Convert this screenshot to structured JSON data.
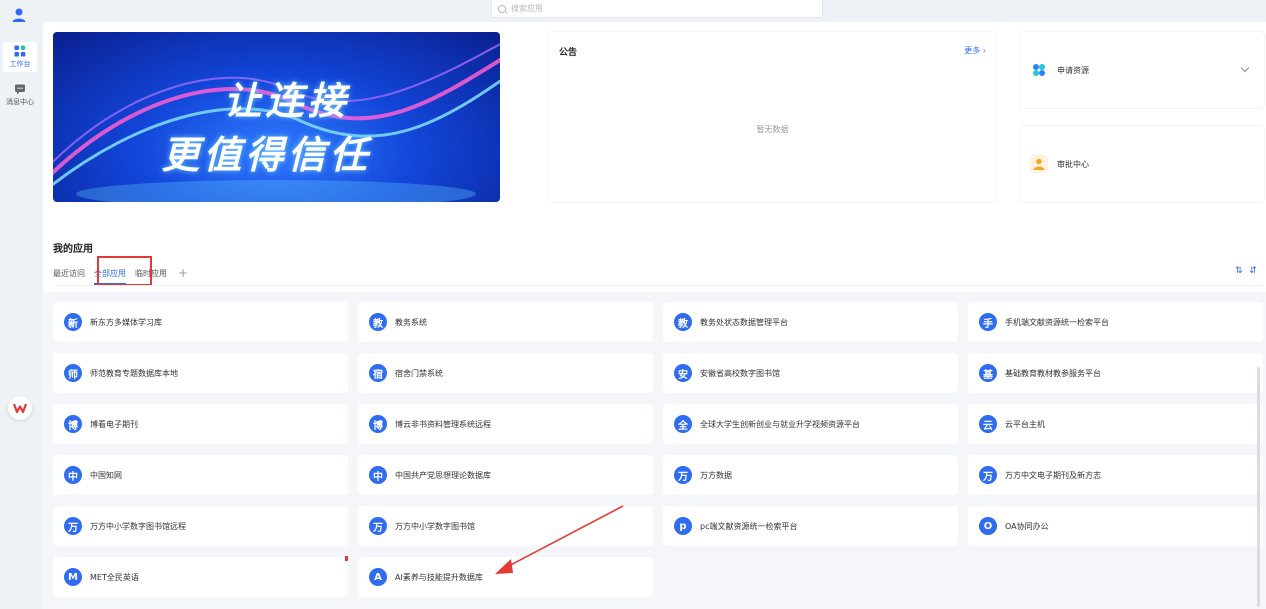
{
  "search": {
    "placeholder": "搜索应用"
  },
  "rail": {
    "items": [
      {
        "label": "工作台"
      },
      {
        "label": "消息中心"
      }
    ]
  },
  "banner": {
    "line1": "让连接",
    "line2": "更值得信任"
  },
  "notice": {
    "title": "公告",
    "more": "更多 ›",
    "empty": "暂无数据"
  },
  "side_cards": [
    {
      "label": "申请资源",
      "icon": "apps-icon",
      "color": "#2f80f5"
    },
    {
      "label": "审批中心",
      "icon": "person-icon",
      "color": "#f5a623"
    }
  ],
  "apps_section": {
    "title": "我的应用",
    "tabs": [
      "最近访问",
      "全部应用",
      "临时应用"
    ],
    "add": "+",
    "sort": "⇅ ⇵"
  },
  "apps": [
    {
      "badge": "新",
      "name": "新东方多媒体学习库"
    },
    {
      "badge": "教",
      "name": "教务系统"
    },
    {
      "badge": "教",
      "name": "教务处状态数据管理平台"
    },
    {
      "badge": "手",
      "name": "手机端文献资源统一检索平台"
    },
    {
      "badge": "师",
      "name": "师范教育专题数据库本地"
    },
    {
      "badge": "宿",
      "name": "宿舍门禁系统"
    },
    {
      "badge": "安",
      "name": "安徽省高校数字图书馆"
    },
    {
      "badge": "基",
      "name": "基础教育教材教参服务平台"
    },
    {
      "badge": "博",
      "name": "博看电子期刊"
    },
    {
      "badge": "博",
      "name": "博云非书资料管理系统远程"
    },
    {
      "badge": "全",
      "name": "全球大学生创新创业与就业升学视频资源平台"
    },
    {
      "badge": "云",
      "name": "云平台主机"
    },
    {
      "badge": "中",
      "name": "中国知网"
    },
    {
      "badge": "中",
      "name": "中国共产党思想理论数据库"
    },
    {
      "badge": "万",
      "name": "万方数据"
    },
    {
      "badge": "万",
      "name": "万方中文电子期刊及新方志"
    },
    {
      "badge": "万",
      "name": "万方中小学数字图书馆远程"
    },
    {
      "badge": "万",
      "name": "万方中小学数字图书馆"
    },
    {
      "badge": "p",
      "name": "pc端文献资源统一检索平台"
    },
    {
      "badge": "O",
      "name": "OA协同办公"
    },
    {
      "badge": "M",
      "name": "MET全民英语"
    },
    {
      "badge": "A",
      "name": "AI素养与技能提升数据库"
    }
  ],
  "colors": {
    "accent": "#3069f5",
    "badge": "#2f6cf0",
    "highlight": "#e53935"
  }
}
